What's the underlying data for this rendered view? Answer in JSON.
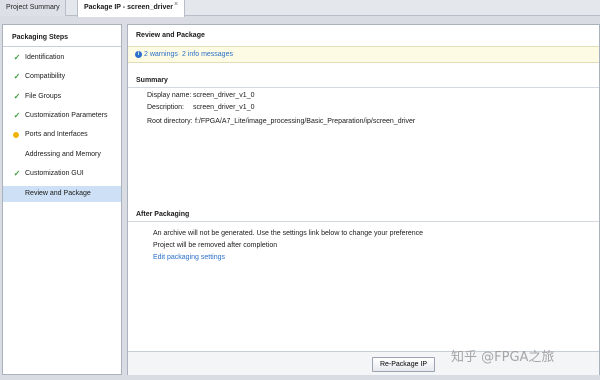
{
  "tabs": {
    "summary": "Project Summary",
    "package": "Package IP - screen_driver",
    "close_glyph": "×"
  },
  "steps_panel": {
    "title": "Packaging Steps",
    "items": [
      {
        "label": "Identification",
        "status": "done"
      },
      {
        "label": "Compatibility",
        "status": "done"
      },
      {
        "label": "File Groups",
        "status": "done"
      },
      {
        "label": "Customization Parameters",
        "status": "done"
      },
      {
        "label": "Ports and Interfaces",
        "status": "warning"
      },
      {
        "label": "Addressing and Memory",
        "status": "none"
      },
      {
        "label": "Customization GUI",
        "status": "done"
      },
      {
        "label": "Review and Package",
        "status": "selected"
      }
    ]
  },
  "review": {
    "title": "Review and Package",
    "messages": {
      "warnings": "2 warnings",
      "separator": "·",
      "info": "2 info messages"
    },
    "summary": {
      "heading": "Summary",
      "display_name_label": "Display name:",
      "display_name": "screen_driver_v1_0",
      "description_label": "Description:",
      "description": "screen_driver_v1_0",
      "root_label": "Root directory:",
      "root": "f:/FPGA/A7_Lite/image_processing/Basic_Preparation/ip/screen_driver"
    },
    "after": {
      "heading": "After Packaging",
      "line1": "An archive will not be generated. Use the settings link below to change your preference",
      "line2": "Project will be removed after completion",
      "settings_link": "Edit packaging settings"
    },
    "button": "Re-Package IP"
  },
  "watermark": "知乎 @FPGA之旅",
  "colors": {
    "check": "#3a9a3a",
    "warning": "#f0b400",
    "link": "#2a6fc9",
    "selected": "#cde0f5",
    "message_bar": "#fdfbe3"
  }
}
